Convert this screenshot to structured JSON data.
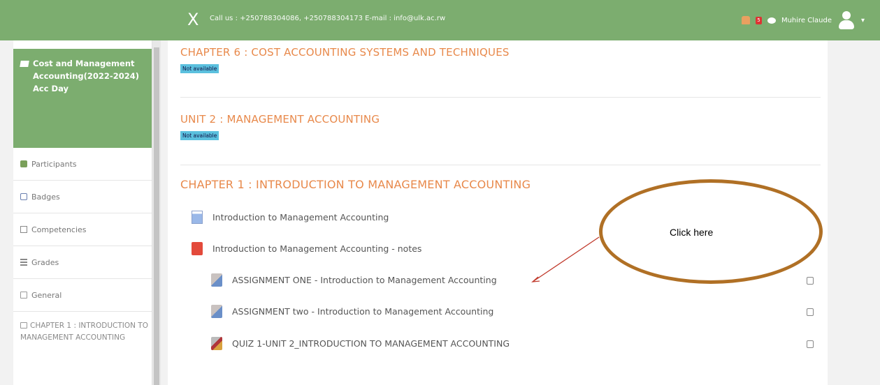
{
  "topbar": {
    "close_glyph": "X",
    "contact": "Call us : +250788304086, +250788304173 E-mail : info@ulk.ac.rw",
    "notification_count": "5",
    "user_name": "Muhire Claude",
    "caret": "▾"
  },
  "sidebar": {
    "course_title": "Cost and Management Accounting(2022-2024) Acc Day",
    "items": [
      {
        "label": "Participants",
        "icon": "people-icon"
      },
      {
        "label": "Badges",
        "icon": "badge-icon"
      },
      {
        "label": "Competencies",
        "icon": "competencies-icon"
      },
      {
        "label": "Grades",
        "icon": "grades-icon"
      },
      {
        "label": "General",
        "icon": "folder-icon"
      }
    ],
    "last_item": "CHAPTER 1 : INTRODUCTION TO MANAGEMENT ACCOUNTING"
  },
  "main": {
    "sections": [
      {
        "title": "CHAPTER 6 : COST ACCOUNTING SYSTEMS AND TECHNIQUES",
        "badge": "Not available"
      },
      {
        "title": "UNIT 2 : MANAGEMENT ACCOUNTING",
        "badge": "Not available"
      },
      {
        "title": "CHAPTER 1 : INTRODUCTION TO MANAGEMENT ACCOUNTING"
      }
    ],
    "activities": [
      {
        "label": "Introduction to Management Accounting",
        "icon": "page-icon"
      },
      {
        "label": "Introduction to Management Accounting - notes",
        "icon": "pdf-icon"
      },
      {
        "label": "ASSIGNMENT ONE - Introduction to Management Accounting",
        "icon": "assignment-icon"
      },
      {
        "label": "ASSIGNMENT two - Introduction to Management Accounting",
        "icon": "assignment-icon"
      },
      {
        "label": "QUIZ 1-UNIT 2_INTRODUCTION TO MANAGEMENT ACCOUNTING",
        "icon": "quiz-icon"
      }
    ]
  },
  "annotation": {
    "text": "Click here",
    "color": "#b07025"
  }
}
